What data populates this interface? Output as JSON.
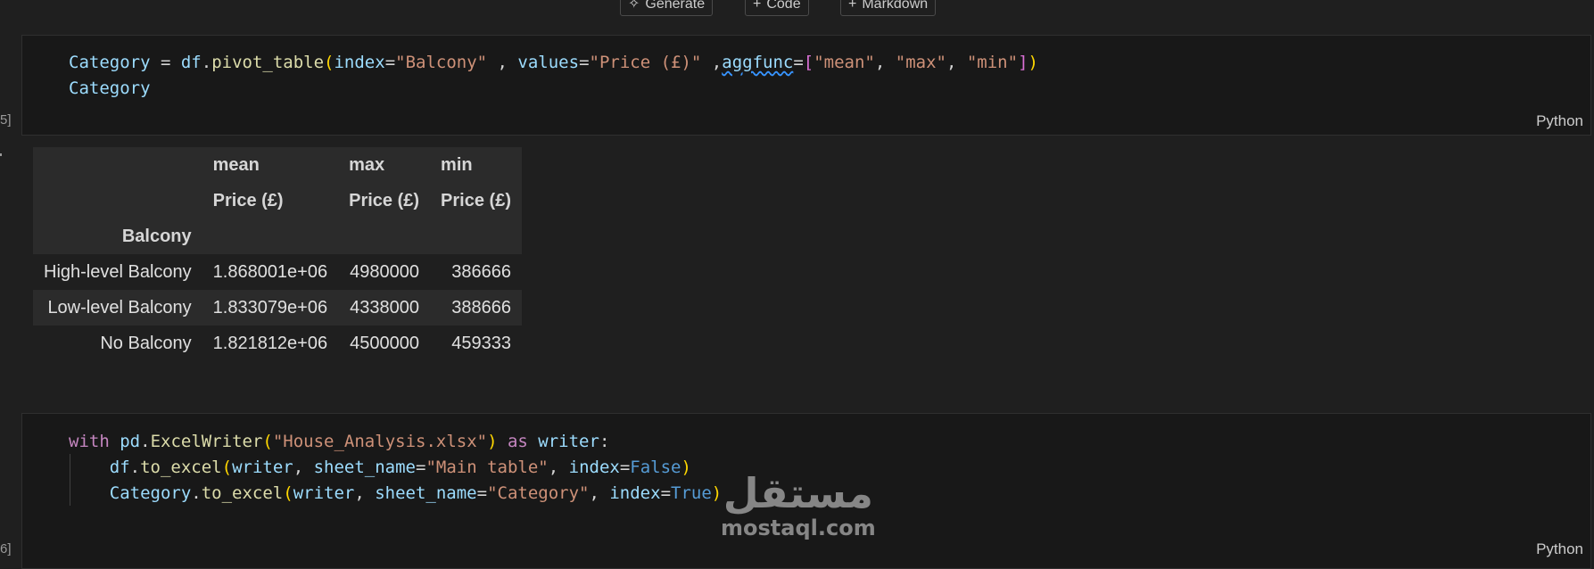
{
  "toolbar": {
    "generate_label": "Generate",
    "code_label": "Code",
    "markdown_label": "Markdown"
  },
  "cell1": {
    "gutter": "5]",
    "lang": "Python",
    "line1": {
      "t1": "Category",
      "t2": " = ",
      "t3": "df",
      "t4": ".",
      "t5": "pivot_table",
      "t6": "(",
      "t7": "index",
      "t8": "=",
      "t9": "\"Balcony\"",
      "t10": " , ",
      "t11": "values",
      "t12": "=",
      "t13": "\"Price (£)\"",
      "t14": " ,",
      "t15": "aggfunc",
      "t16": "=",
      "t17": "[",
      "t18": "\"mean\"",
      "t19": ", ",
      "t20": "\"max\"",
      "t21": ", ",
      "t22": "\"min\"",
      "t23": "]",
      "t24": ")"
    },
    "line2": "Category"
  },
  "output": {
    "columns_row1": [
      "",
      "mean",
      "max",
      "min"
    ],
    "columns_row2": [
      "",
      "Price (£)",
      "Price (£)",
      "Price (£)"
    ],
    "index_name": "Balcony",
    "rows": [
      {
        "label": "High-level Balcony",
        "mean": "1.868001e+06",
        "max": "4980000",
        "min": "386666"
      },
      {
        "label": "Low-level Balcony",
        "mean": "1.833079e+06",
        "max": "4338000",
        "min": "388666"
      },
      {
        "label": "No Balcony",
        "mean": "1.821812e+06",
        "max": "4500000",
        "min": "459333"
      }
    ]
  },
  "cell2": {
    "gutter": "6]",
    "lang": "Python",
    "line1": {
      "t1": "with",
      "t2": " ",
      "t3": "pd",
      "t4": ".",
      "t5": "ExcelWriter",
      "t6": "(",
      "t7": "\"House_Analysis.xlsx\"",
      "t8": ")",
      "t9": " as ",
      "t10": "writer",
      "t11": ":"
    },
    "line2": {
      "t1": "df",
      "t2": ".",
      "t3": "to_excel",
      "t4": "(",
      "t5": "writer",
      "t6": ", ",
      "t7": "sheet_name",
      "t8": "=",
      "t9": "\"Main table\"",
      "t10": ", ",
      "t11": "index",
      "t12": "=",
      "t13": "False",
      "t14": ")"
    },
    "line3": {
      "t1": "Category",
      "t2": ".",
      "t3": "to_excel",
      "t4": "(",
      "t5": "writer",
      "t6": ", ",
      "t7": "sheet_name",
      "t8": "=",
      "t9": "\"Category\"",
      "t10": ", ",
      "t11": "index",
      "t12": "=",
      "t13": "True",
      "t14": ")"
    }
  },
  "watermark": {
    "arabic": "مستقل",
    "latin": "mostaql.com"
  }
}
